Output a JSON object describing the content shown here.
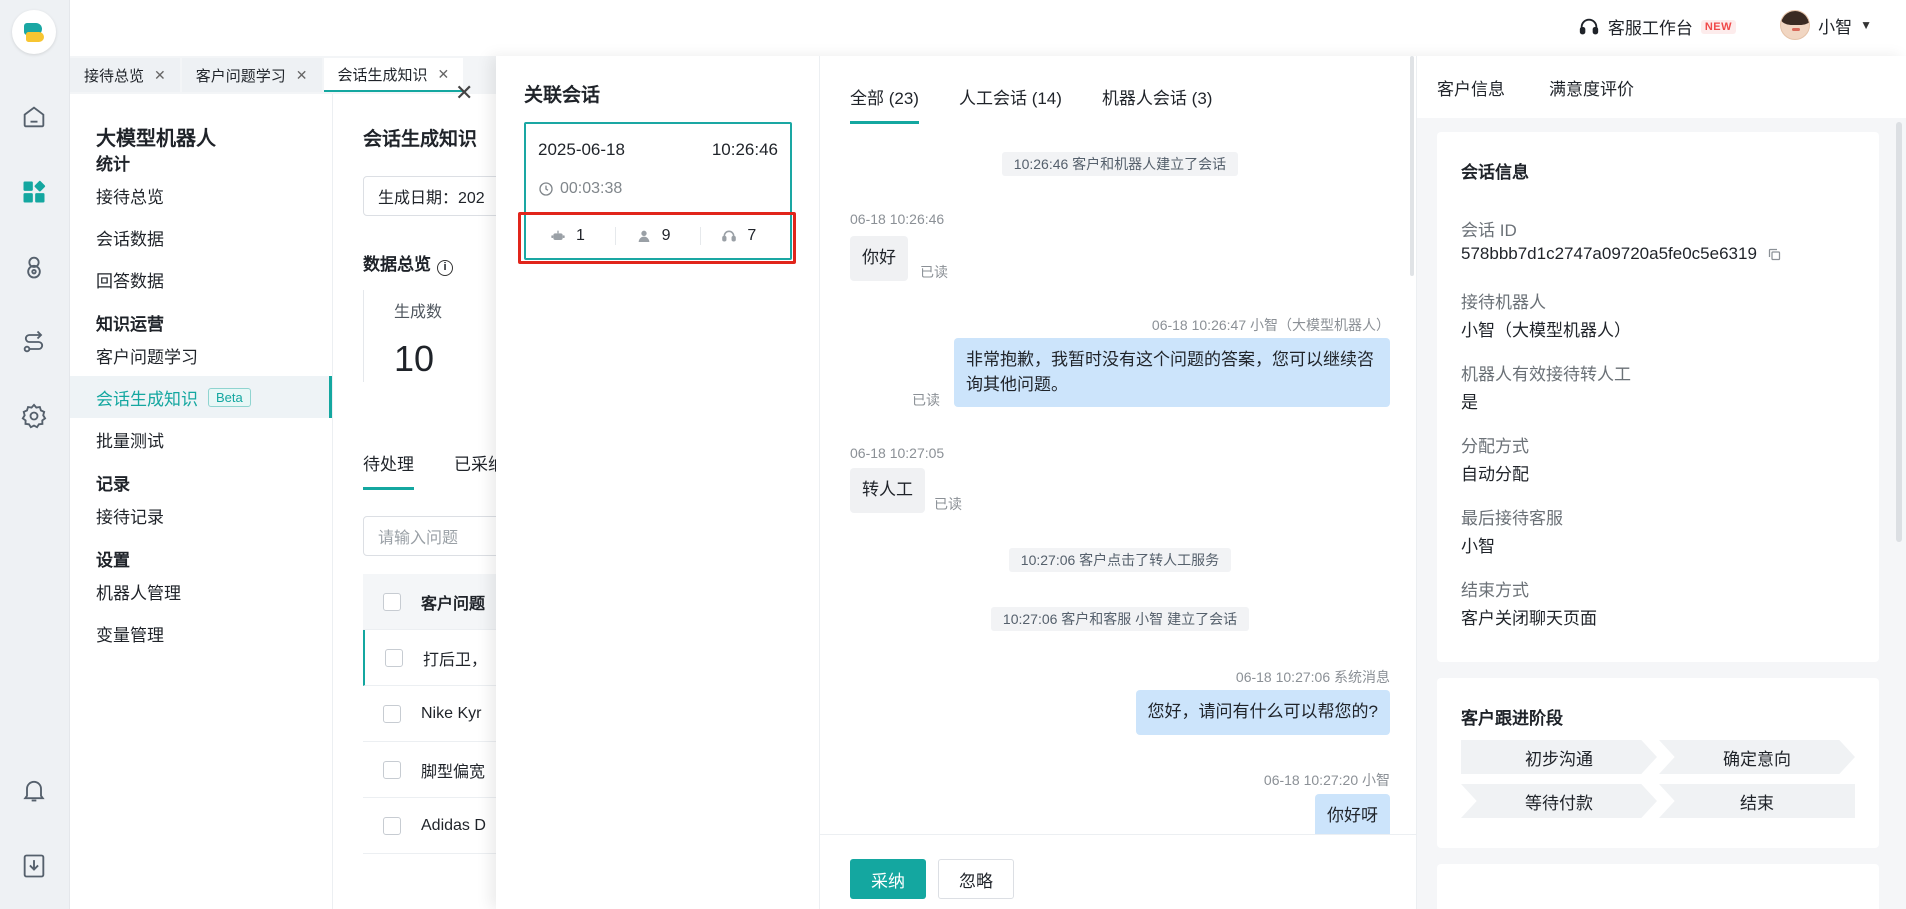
{
  "header": {
    "workbench_label": "客服工作台",
    "new_badge": "NEW",
    "user_name": "小智"
  },
  "tabs": [
    {
      "label": "接待总览"
    },
    {
      "label": "客户问题学习"
    },
    {
      "label": "会话生成知识"
    }
  ],
  "nav": {
    "title": "大模型机器人",
    "sections": [
      {
        "title": "统计",
        "items": [
          "接待总览",
          "会话数据",
          "回答数据"
        ]
      },
      {
        "title": "知识运营",
        "items": [
          "客户问题学习",
          "会话生成知识",
          "批量测试"
        ]
      },
      {
        "title": "记录",
        "items": [
          "接待记录"
        ]
      },
      {
        "title": "设置",
        "items": [
          "机器人管理",
          "变量管理"
        ]
      }
    ],
    "beta_badge": "Beta"
  },
  "page": {
    "title": "会话生成知识",
    "date_filter": "生成日期：202",
    "overview_title": "数据总览",
    "stat_label": "生成数",
    "stat_value": "10",
    "tab_pending": "待处理",
    "tab_adopted": "已采纳",
    "search_placeholder": "请输入问题",
    "table_header": "客户问题",
    "rows": [
      "打后卫，",
      "Nike Kyr",
      "脚型偏宽",
      "Adidas D"
    ]
  },
  "related": {
    "title": "关联会话",
    "date": "2025-06-18",
    "time": "10:26:46",
    "duration": "00:03:38",
    "robot_count": "1",
    "human_count": "9",
    "transfer_count": "7"
  },
  "chat": {
    "tabs": [
      {
        "label": "全部 (23)"
      },
      {
        "label": "人工会话 (14)"
      },
      {
        "label": "机器人会话 (3)"
      }
    ],
    "sys1": "10:26:46 客户和机器人建立了会话",
    "m1_meta": "06-18 10:26:46",
    "m1_text": "你好",
    "read": "已读",
    "m2_meta": "06-18 10:26:47  小智（大模型机器人）",
    "m2_text": "非常抱歉，我暂时没有这个问题的答案，您可以继续咨询其他问题。",
    "m3_meta": "06-18 10:27:05",
    "m3_text": "转人工",
    "sys2": "10:27:06 客户点击了转人工服务",
    "sys3": "10:27:06 客户和客服 小智 建立了会话",
    "m4_meta": "06-18 10:27:06   系统消息",
    "m4_text": "您好，请问有什么可以帮您的?",
    "m5_meta": "06-18 10:27:20   小智",
    "m5_text": "你好呀",
    "adopt_label": "采纳",
    "ignore_label": "忽略"
  },
  "info": {
    "tab_customer": "客户信息",
    "tab_satisfaction": "满意度评价",
    "card_title": "会话信息",
    "fields": [
      {
        "label": "会话 ID",
        "value": "578bbb7d1c2747a09720a5fe0c5e6319"
      },
      {
        "label": "接待机器人",
        "value": "小智（大模型机器人）"
      },
      {
        "label": "机器人有效接待转人工",
        "value": "是"
      },
      {
        "label": "分配方式",
        "value": "自动分配"
      },
      {
        "label": "最后接待客服",
        "value": "小智"
      },
      {
        "label": "结束方式",
        "value": "客户关闭聊天页面"
      }
    ],
    "stage_title": "客户跟进阶段",
    "stages": [
      "初步沟通",
      "确定意向",
      "等待付款",
      "结束"
    ]
  }
}
